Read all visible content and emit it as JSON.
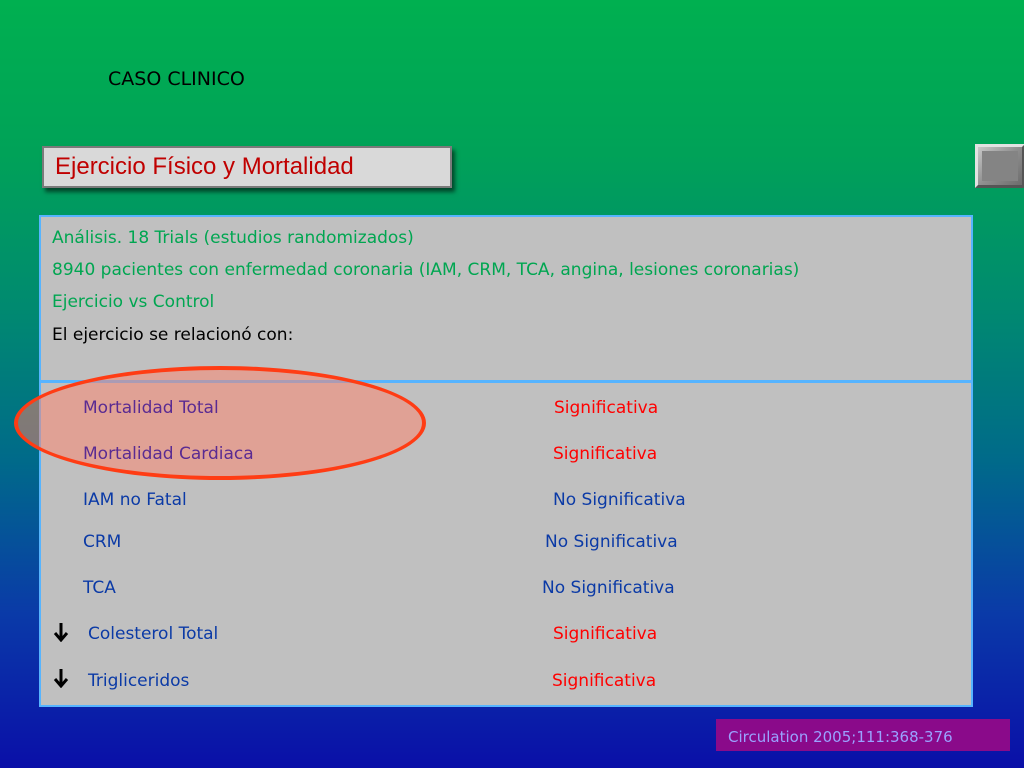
{
  "slide": {
    "heading": "CASO CLINICO",
    "title": "Ejercicio Físico y Mortalidad",
    "citation": "Circulation 2005;111:368-376"
  },
  "intro": [
    "Análisis. 18 Trials (estudios randomizados)",
    "8940 pacientes con enfermedad coronaria (IAM, CRM, TCA, angina, lesiones coronarias)",
    "Ejercicio vs Control",
    "El ejercicio se relacionó con:"
  ],
  "results": [
    {
      "label": "Mortalidad Total",
      "value": "Significativa",
      "arrow": "",
      "highlighted": true
    },
    {
      "label": "Mortalidad Cardiaca",
      "value": "Significativa",
      "arrow": "",
      "highlighted": true
    },
    {
      "label": "IAM no Fatal",
      "value": "No Significativa",
      "arrow": "",
      "highlighted": false
    },
    {
      "label": "CRM",
      "value": "No Significativa",
      "arrow": "",
      "highlighted": false
    },
    {
      "label": "TCA",
      "value": "No Significativa",
      "arrow": "",
      "highlighted": false
    },
    {
      "label": "Colesterol Total",
      "value": "Significativa",
      "arrow": "down-arrow-icon",
      "highlighted": false
    },
    {
      "label": "Trigliceridos",
      "value": "Significativa",
      "arrow": "down-arrow-icon",
      "highlighted": false
    }
  ],
  "colors": {
    "significant": "#ff0000",
    "not_significant": "#0b3aa6",
    "highlight_label": "#5a2b92",
    "intro_text": "#00a651",
    "title_text": "#c00000",
    "panel_border": "#56b4ff",
    "highlight_ring": "#ff3c14"
  }
}
